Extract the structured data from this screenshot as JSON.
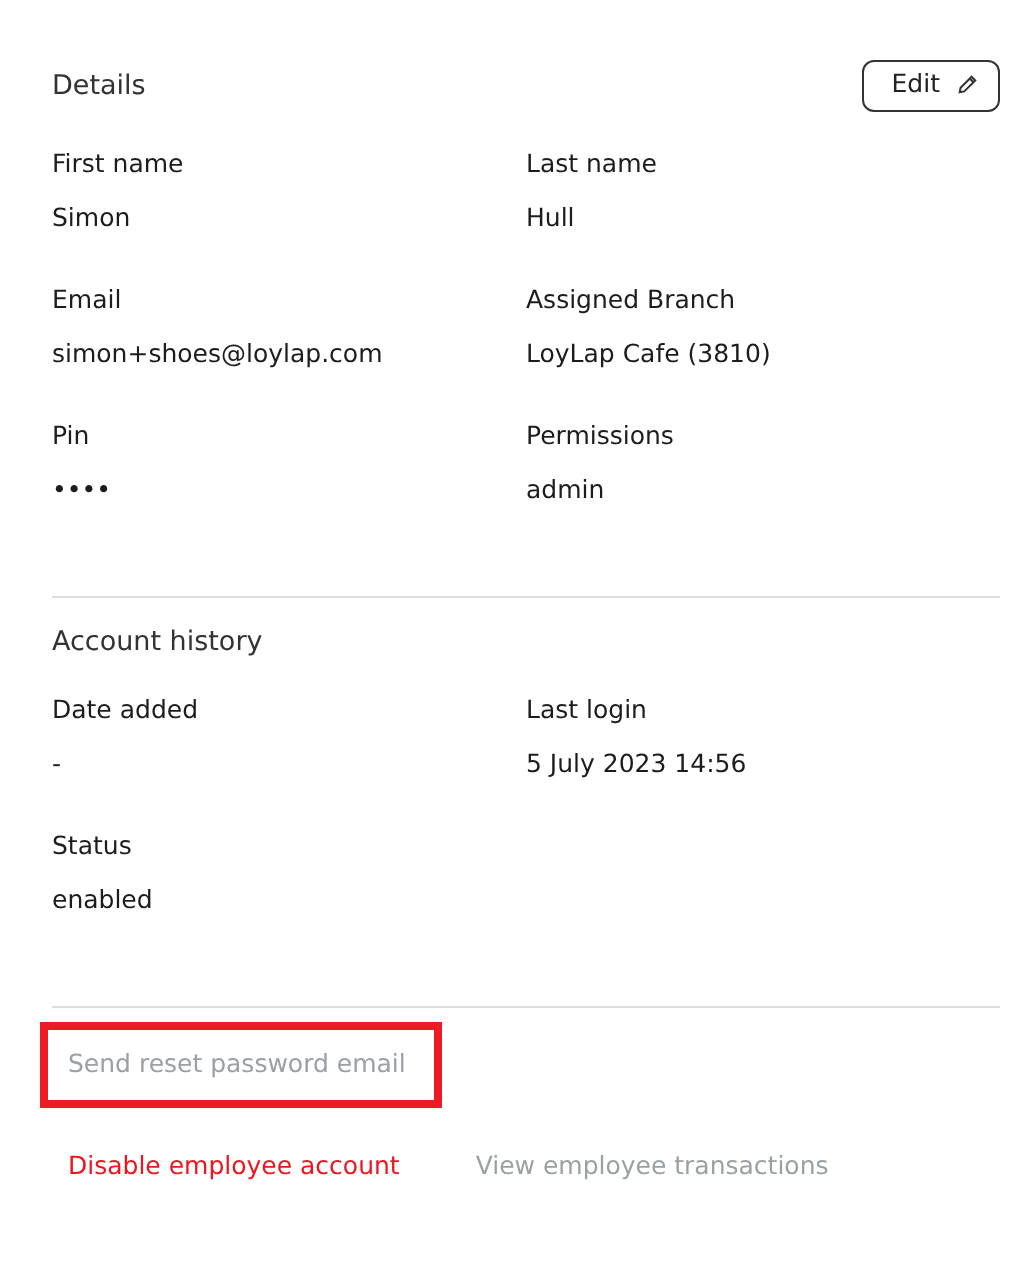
{
  "details": {
    "title": "Details",
    "edit_button": "Edit",
    "fields": [
      {
        "label": "First name",
        "value": "Simon"
      },
      {
        "label": "Last name",
        "value": "Hull"
      },
      {
        "label": "Email",
        "value": "simon+shoes@loylap.com"
      },
      {
        "label": "Assigned Branch",
        "value": "LoyLap Cafe (3810)"
      },
      {
        "label": "Pin",
        "value": "••••"
      },
      {
        "label": "Permissions",
        "value": "admin"
      }
    ]
  },
  "account_history": {
    "title": "Account history",
    "fields": [
      {
        "label": "Date added",
        "value": "-"
      },
      {
        "label": "Last login",
        "value": "5 July 2023 14:56"
      },
      {
        "label": "Status",
        "value": "enabled"
      }
    ]
  },
  "actions": [
    {
      "label": "Send reset password email",
      "kind": "muted",
      "highlighted": true
    },
    {
      "label": "Disable employee account",
      "kind": "danger",
      "highlighted": false
    },
    {
      "label": "View employee transactions",
      "kind": "muted",
      "highlighted": false
    }
  ]
}
